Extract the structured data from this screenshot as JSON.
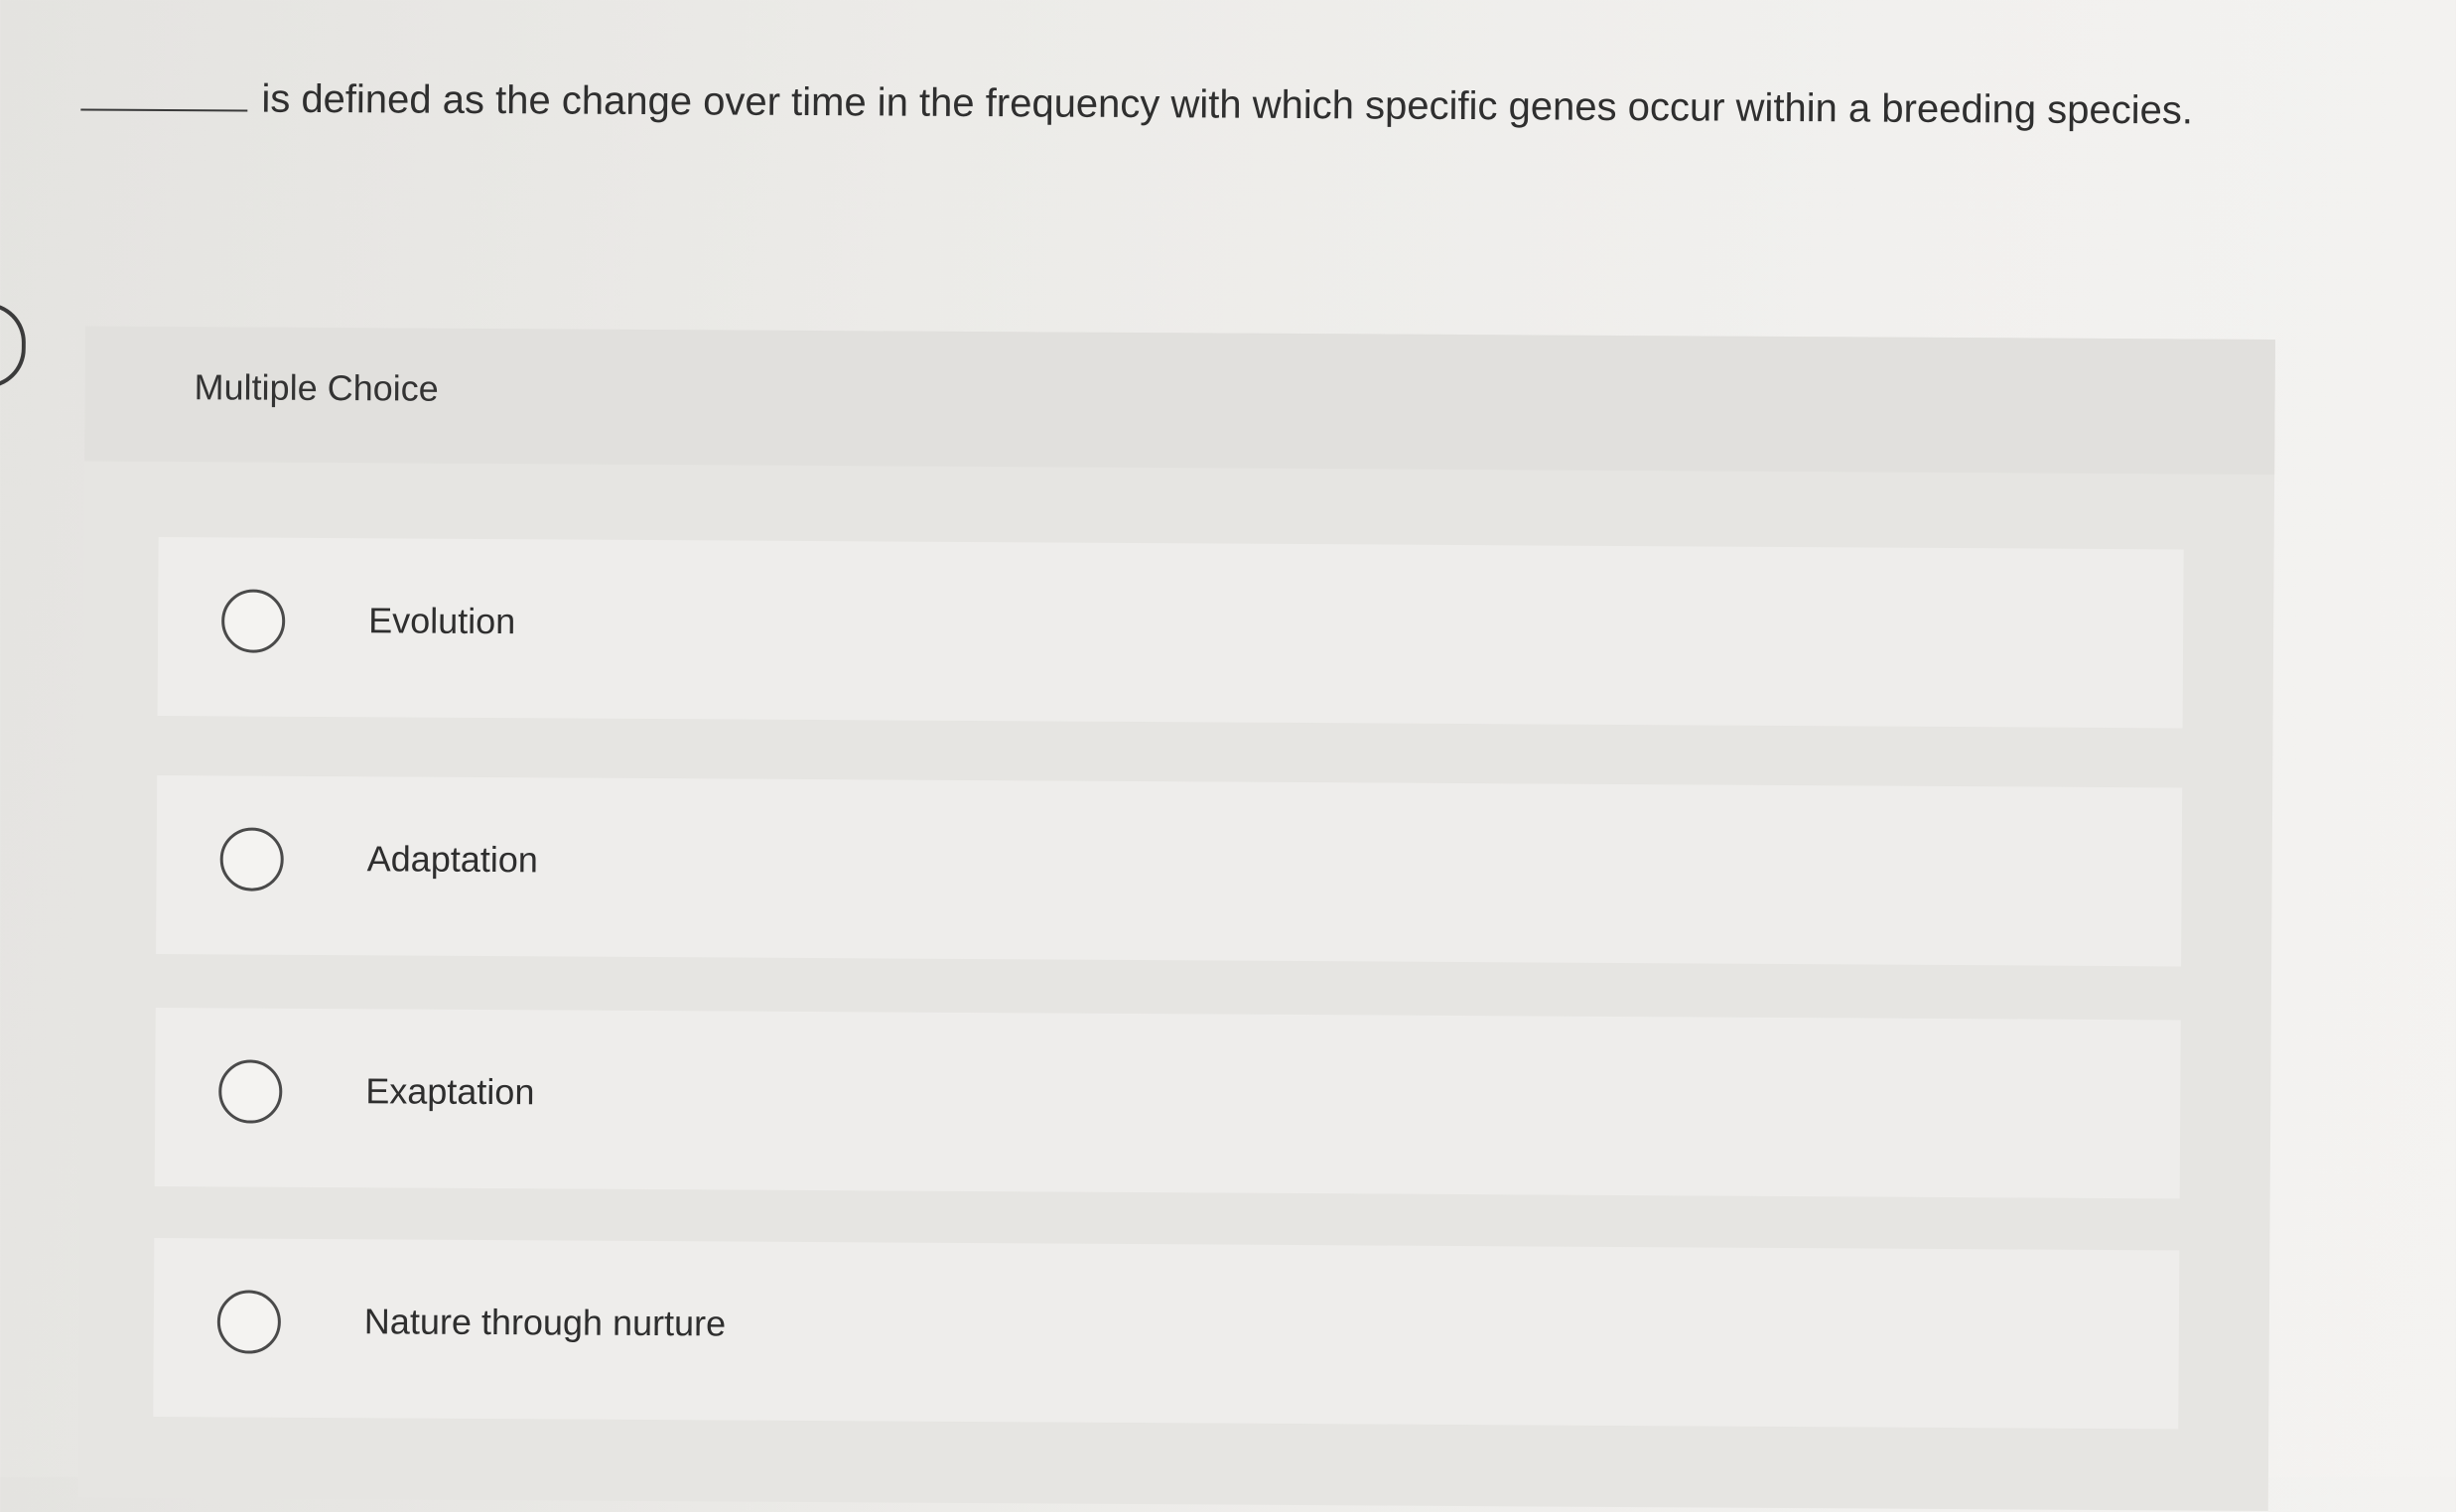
{
  "question": {
    "text": "is defined as the change over time in the frequency with which specific genes occur within a breeding species."
  },
  "multiple_choice": {
    "label": "Multiple Choice",
    "options": [
      {
        "label": "Evolution",
        "selected": false
      },
      {
        "label": "Adaptation",
        "selected": false
      },
      {
        "label": "Exaptation",
        "selected": false
      },
      {
        "label": "Nature through nurture",
        "selected": false
      }
    ]
  },
  "icons": {
    "radio": "radio-unchecked-icon"
  }
}
